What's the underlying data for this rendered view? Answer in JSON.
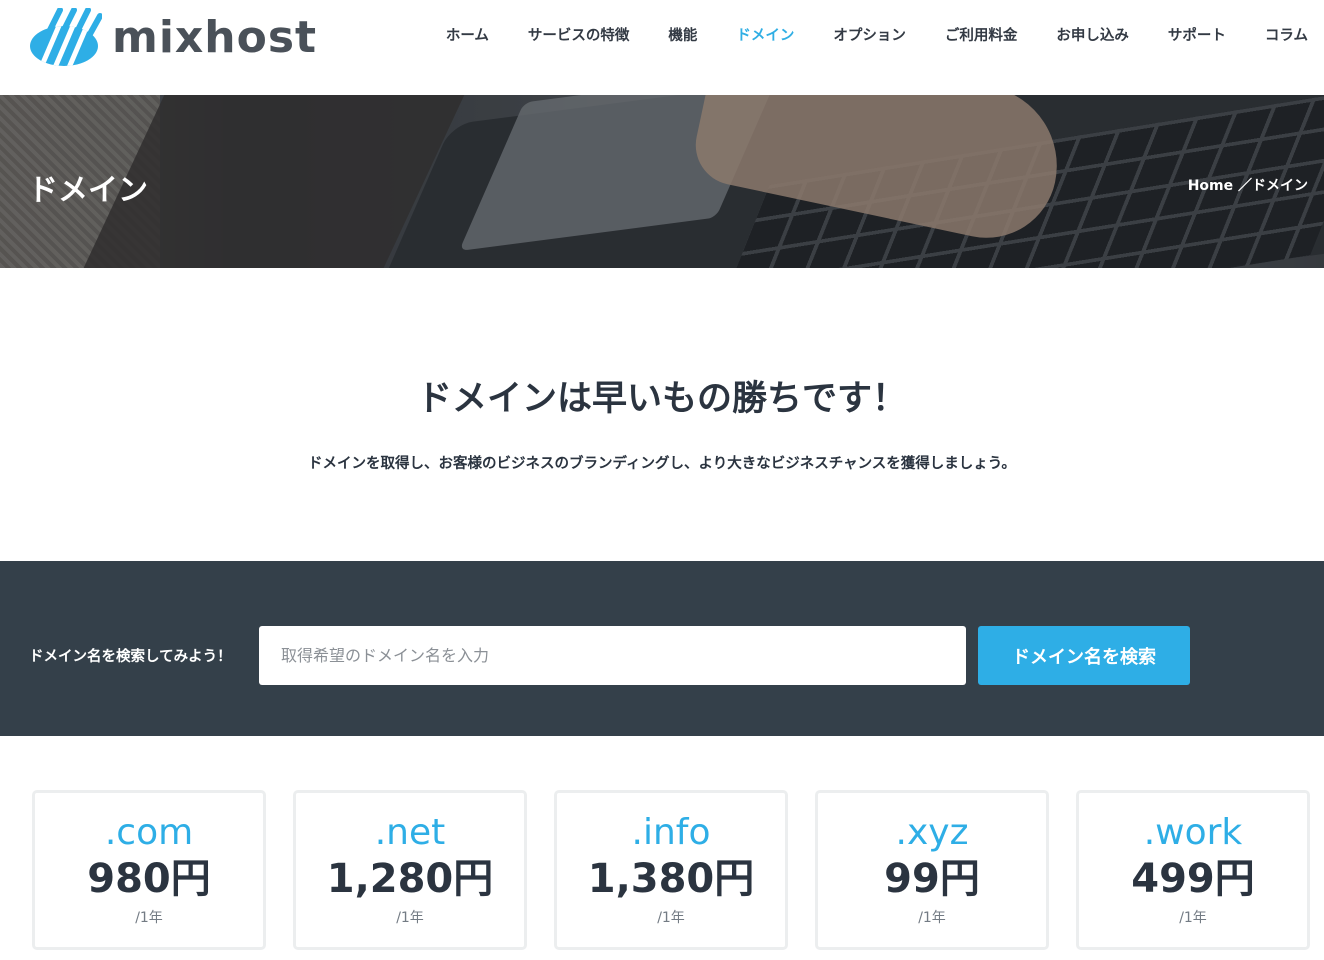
{
  "header": {
    "logo_text": "mixhost",
    "nav": [
      {
        "label": "ホーム"
      },
      {
        "label": "サービスの特徴"
      },
      {
        "label": "機能"
      },
      {
        "label": "ドメイン",
        "active": true
      },
      {
        "label": "オプション"
      },
      {
        "label": "ご利用料金"
      },
      {
        "label": "お申し込み"
      },
      {
        "label": "サポート"
      },
      {
        "label": "コラム"
      }
    ]
  },
  "hero": {
    "title": "ドメイン",
    "breadcrumb": {
      "home": "Home",
      "separator": " ／",
      "current": "ドメイン"
    }
  },
  "intro": {
    "title": "ドメインは早いもの勝ちです！",
    "text": "ドメインを取得し、お客様のビジネスのブランディングし、より大きなビジネスチャンスを獲得しましょう。"
  },
  "search": {
    "label": "ドメイン名を検索してみよう！",
    "placeholder": "取得希望のドメイン名を入力",
    "value": "",
    "button_label": "ドメイン名を検索"
  },
  "pricing": [
    {
      "tld": ".com",
      "price": "980円",
      "period": "/1年"
    },
    {
      "tld": ".net",
      "price": "1,280円",
      "period": "/1年"
    },
    {
      "tld": ".info",
      "price": "1,380円",
      "period": "/1年"
    },
    {
      "tld": ".xyz",
      "price": "99円",
      "period": "/1年"
    },
    {
      "tld": ".work",
      "price": "499円",
      "period": "/1年"
    }
  ],
  "colors": {
    "accent": "#2eaee6",
    "dark_band": "#34404a",
    "text": "#2b3440"
  }
}
